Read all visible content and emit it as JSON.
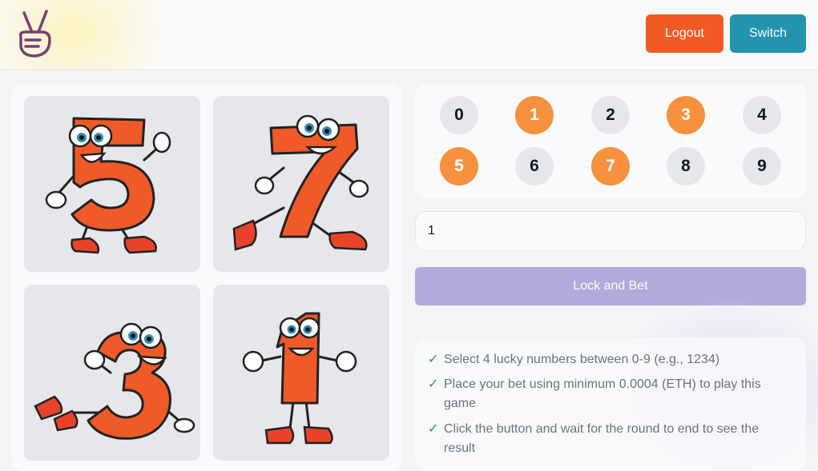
{
  "header": {
    "logo_icon": "peace-hand-icon",
    "logout_label": "Logout",
    "switch_label": "Switch",
    "logout_color": "#f15a24",
    "switch_color": "#2393b0"
  },
  "cards": [
    {
      "digit": "5",
      "character": "running-digit-five"
    },
    {
      "digit": "7",
      "character": "running-digit-seven"
    },
    {
      "digit": "3",
      "character": "sitting-digit-three"
    },
    {
      "digit": "1",
      "character": "standing-digit-one"
    }
  ],
  "numbers": [
    {
      "label": "0",
      "selected": false
    },
    {
      "label": "1",
      "selected": true
    },
    {
      "label": "2",
      "selected": false
    },
    {
      "label": "3",
      "selected": true
    },
    {
      "label": "4",
      "selected": false
    },
    {
      "label": "5",
      "selected": true
    },
    {
      "label": "6",
      "selected": false
    },
    {
      "label": "7",
      "selected": true
    },
    {
      "label": "8",
      "selected": false
    },
    {
      "label": "9",
      "selected": false
    }
  ],
  "bet": {
    "value": "1",
    "button_label": "Lock and Bet"
  },
  "instructions": [
    "Select 4 lucky numbers between 0-9 (e.g., 1234)",
    "Place your bet using minimum 0.0004 (ETH) to play this game",
    "Click the button and wait for the round to end to see the result"
  ],
  "colors": {
    "selected_number": "#f7913d",
    "unselected_number": "#e5e7eb",
    "lock_button": "#b3a9dc",
    "check": "#16a34a",
    "digit_orange": "#f05a28"
  }
}
